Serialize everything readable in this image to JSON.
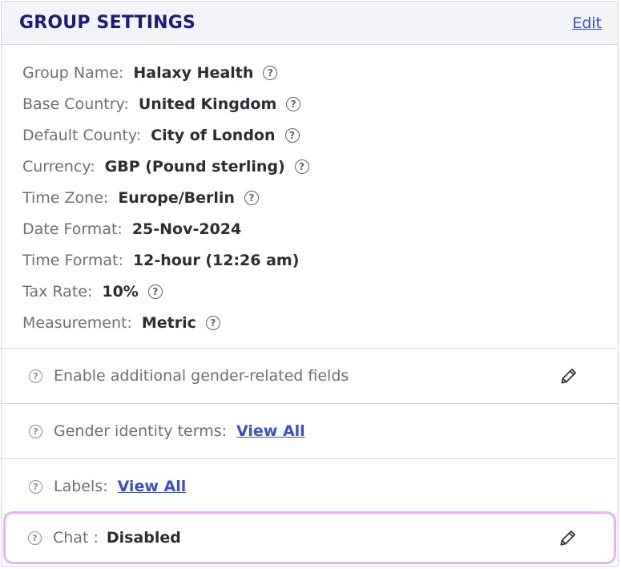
{
  "header": {
    "title": "GROUP SETTINGS",
    "edit_label": "Edit"
  },
  "settings": [
    {
      "label": "Group Name:",
      "value": "Halaxy Health",
      "help": true
    },
    {
      "label": "Base Country:",
      "value": "United Kingdom",
      "help": true
    },
    {
      "label": "Default County:",
      "value": "City of London",
      "help": true
    },
    {
      "label": "Currency:",
      "value": "GBP (Pound sterling)",
      "help": true
    },
    {
      "label": "Time Zone:",
      "value": "Europe/Berlin",
      "help": true
    },
    {
      "label": "Date Format:",
      "value": "25-Nov-2024",
      "help": false
    },
    {
      "label": "Time Format:",
      "value": "12-hour (12:26 am)",
      "help": false
    },
    {
      "label": "Tax Rate:",
      "value": "10%",
      "help": true
    },
    {
      "label": "Measurement:",
      "value": "Metric",
      "help": true
    }
  ],
  "sections": {
    "gender_fields": {
      "label": "Enable additional gender-related fields",
      "icon": "pencil-icon"
    },
    "gender_terms": {
      "label": "Gender identity terms:",
      "link": "View All"
    },
    "labels": {
      "label": "Labels:",
      "link": "View All"
    },
    "chat": {
      "label": "Chat :",
      "value": "Disabled",
      "icon": "pencil-icon"
    }
  },
  "colors": {
    "title": "#1d1a7c",
    "link": "#3d4fc7",
    "highlight_border": "#e7b6f2"
  }
}
